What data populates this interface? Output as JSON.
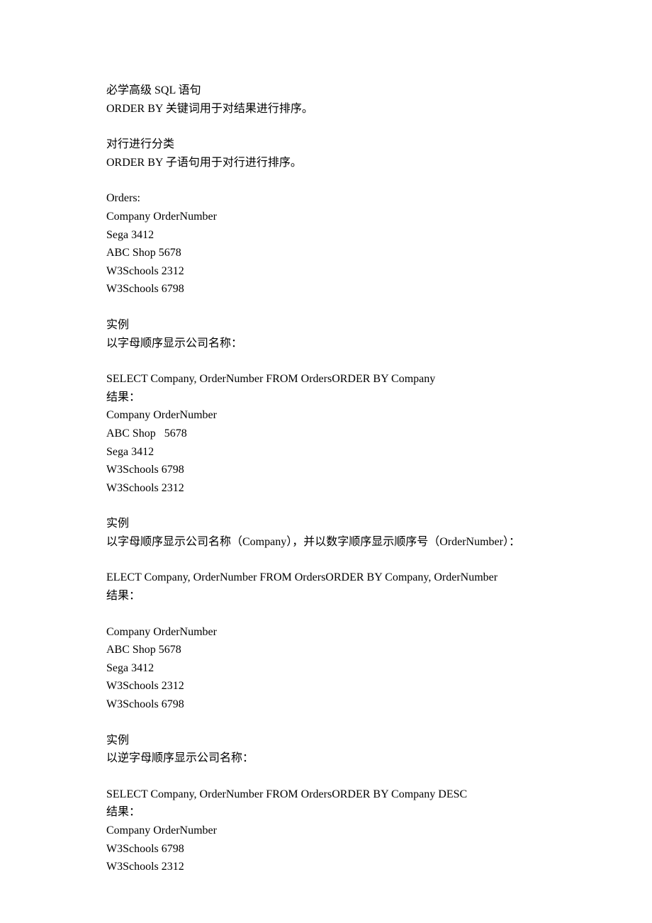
{
  "lines": [
    "必学高级 SQL 语句",
    "ORDER BY 关键词用于对结果进行排序。",
    "",
    "对行进行分类",
    "ORDER BY 子语句用于对行进行排序。",
    "",
    "Orders:",
    "Company OrderNumber",
    "Sega 3412",
    "ABC Shop 5678",
    "W3Schools 2312",
    "W3Schools 6798",
    "",
    "实例",
    "以字母顺序显示公司名称：",
    "",
    "SELECT Company, OrderNumber FROM OrdersORDER BY Company",
    "结果：",
    "Company OrderNumber",
    "ABC Shop   5678",
    "Sega 3412",
    "W3Schools 6798",
    "W3Schools 2312",
    "",
    "实例",
    "以字母顺序显示公司名称（Company），并以数字顺序显示顺序号（OrderNumber）：",
    "",
    "ELECT Company, OrderNumber FROM OrdersORDER BY Company, OrderNumber",
    "结果：",
    "",
    "Company OrderNumber",
    "ABC Shop 5678",
    "Sega 3412",
    "W3Schools 2312",
    "W3Schools 6798",
    "",
    "实例",
    "以逆字母顺序显示公司名称：",
    "",
    "SELECT Company, OrderNumber FROM OrdersORDER BY Company DESC",
    "结果：",
    "Company OrderNumber",
    "W3Schools 6798",
    "W3Schools 2312"
  ]
}
